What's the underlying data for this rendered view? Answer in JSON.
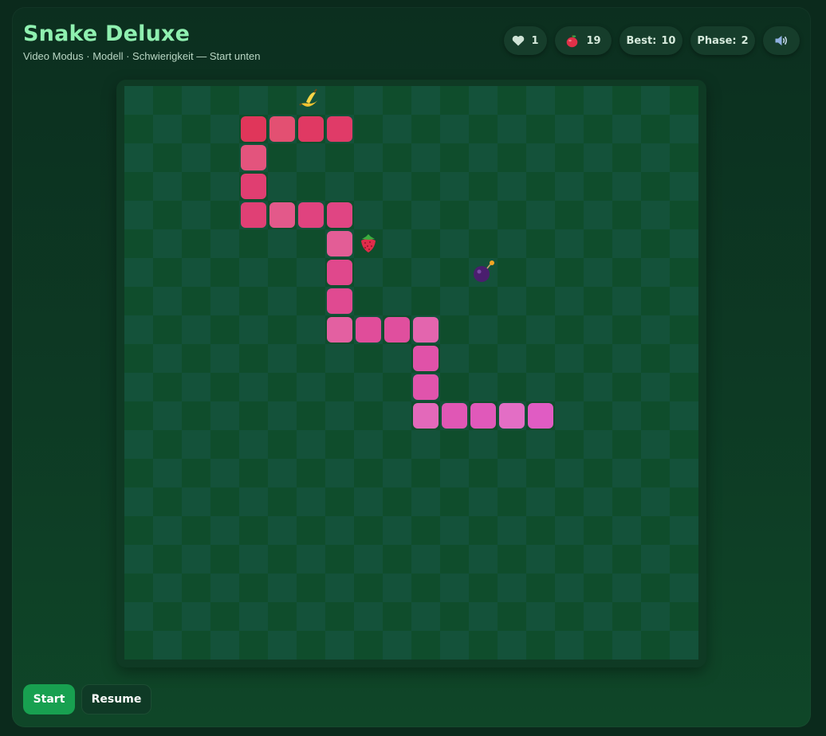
{
  "header": {
    "title": "Snake Deluxe",
    "subtitle": "Video Modus · Modell · Schwierigkeit — Start unten"
  },
  "stats": {
    "lives": "1",
    "apples": "19",
    "best_label": "Best:",
    "best_value": "10",
    "phase_label": "Phase:",
    "phase_value": "2"
  },
  "icons": {
    "lives": "heart-icon",
    "apples": "apple-icon",
    "sound": "speaker-icon"
  },
  "board": {
    "cols": 20,
    "rows": 20,
    "colors": {
      "tile_a": "#0f4d2c",
      "tile_b": "#14523a",
      "snake_head": "#e0365a",
      "snake_tail": "#e05cc3"
    },
    "snake": [
      [
        4,
        1
      ],
      [
        5,
        1
      ],
      [
        6,
        1
      ],
      [
        7,
        1
      ],
      [
        4,
        2
      ],
      [
        4,
        3
      ],
      [
        4,
        4
      ],
      [
        5,
        4
      ],
      [
        6,
        4
      ],
      [
        7,
        4
      ],
      [
        7,
        5
      ],
      [
        7,
        6
      ],
      [
        7,
        7
      ],
      [
        7,
        8
      ],
      [
        8,
        8
      ],
      [
        9,
        8
      ],
      [
        10,
        8
      ],
      [
        10,
        9
      ],
      [
        10,
        10
      ],
      [
        10,
        11
      ],
      [
        11,
        11
      ],
      [
        12,
        11
      ],
      [
        13,
        11
      ],
      [
        14,
        11
      ]
    ],
    "items": [
      {
        "type": "banana",
        "col": 6,
        "row": 0
      },
      {
        "type": "strawberry",
        "col": 8,
        "row": 5
      },
      {
        "type": "bomb",
        "col": 12,
        "row": 6
      }
    ]
  },
  "controls": {
    "start_label": "Start",
    "resume_label": "Resume"
  }
}
